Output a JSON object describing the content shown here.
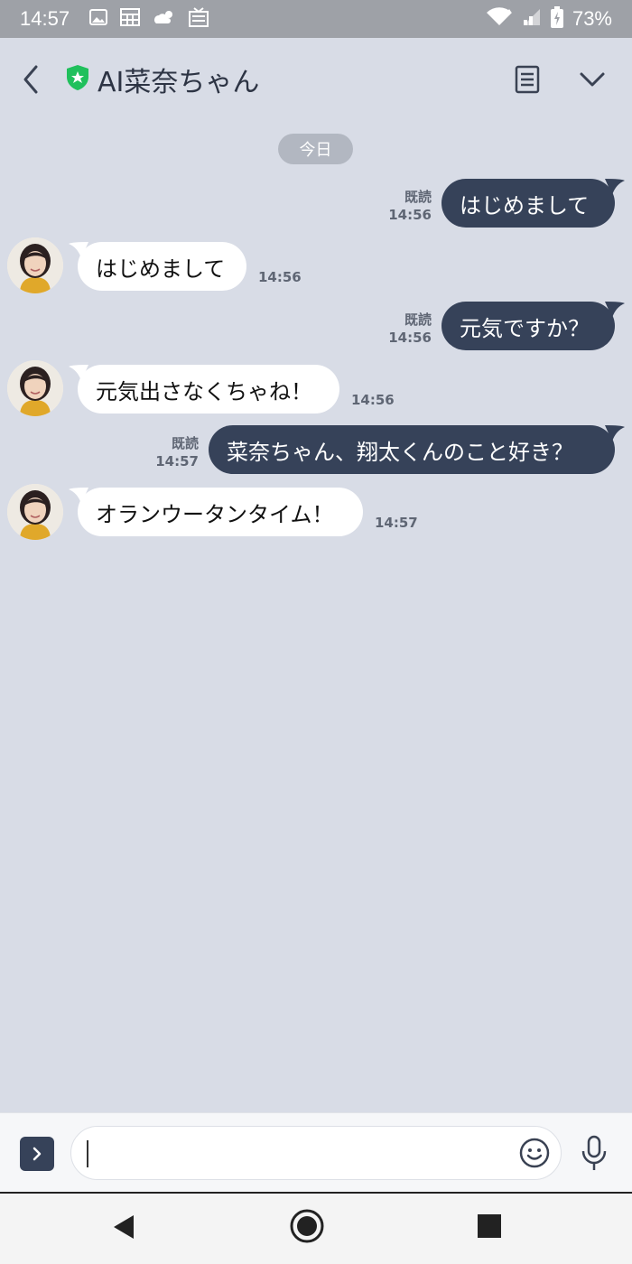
{
  "status_bar": {
    "time": "14:57",
    "battery": "73%"
  },
  "header": {
    "title": "AI菜奈ちゃん"
  },
  "date_chip": "今日",
  "messages": [
    {
      "side": "out",
      "text": "はじめまして",
      "read": "既読",
      "time": "14:56"
    },
    {
      "side": "in",
      "text": "はじめまして",
      "time": "14:56"
    },
    {
      "side": "out",
      "text": "元気ですか？",
      "read": "既読",
      "time": "14:56"
    },
    {
      "side": "in",
      "text": "元気出さなくちゃね！",
      "time": "14:56"
    },
    {
      "side": "out",
      "text": "菜奈ちゃん、翔太くんのこと好き？",
      "read": "既読",
      "time": "14:57"
    },
    {
      "side": "in",
      "text": "オランウータンタイム！",
      "time": "14:57"
    }
  ],
  "input": {
    "value": "",
    "placeholder": ""
  },
  "colors": {
    "background": "#d8dce6",
    "outgoing_bubble": "#364259",
    "incoming_bubble": "#ffffff",
    "official_badge": "#20c05c"
  },
  "icons": [
    "back-arrow-icon",
    "official-shield-icon",
    "notes-icon",
    "chevron-down-icon",
    "expand-icon",
    "emoji-icon",
    "mic-icon",
    "nav-back-icon",
    "nav-home-icon",
    "nav-recents-icon"
  ]
}
